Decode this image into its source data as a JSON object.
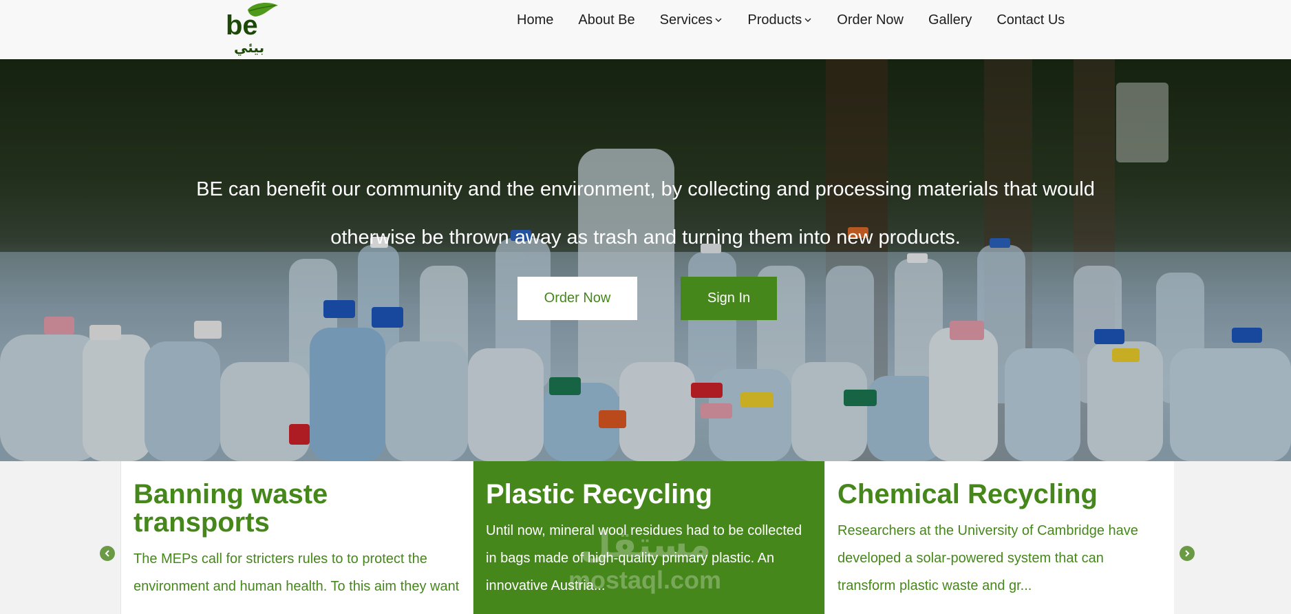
{
  "header": {
    "logo_text": "be",
    "logo_arabic": "بيئي",
    "nav": [
      {
        "label": "Home"
      },
      {
        "label": "About Be"
      },
      {
        "label": "Services"
      },
      {
        "label": "Products"
      },
      {
        "label": "Order Now"
      },
      {
        "label": "Gallery"
      },
      {
        "label": "Contact Us"
      }
    ]
  },
  "hero": {
    "line1": "BE can benefit our community and the environment, by collecting and processing materials that would",
    "line2": "otherwise be thrown away as trash and turning them into new products.",
    "order_label": "Order Now",
    "signin_label": "Sign In"
  },
  "cards": [
    {
      "title": "Banning waste transports",
      "text": "The MEPs call for stricters rules to to protect the environment and human health. To this aim they want"
    },
    {
      "title": "Plastic Recycling",
      "text": "Until now, mineral wool residues had to be collected in bags made of high-quality primary plastic. An innovative Austria..."
    },
    {
      "title": "Chemical Recycling",
      "text": "Researchers at the University of Cambridge have developed a solar-powered system that can transform plastic waste and gr..."
    }
  ],
  "watermark": {
    "arabic": "مستقل",
    "latin": "mostaql.com"
  },
  "colors": {
    "brand_green": "#45871a",
    "header_bg": "#f8f8f8",
    "white": "#ffffff"
  }
}
